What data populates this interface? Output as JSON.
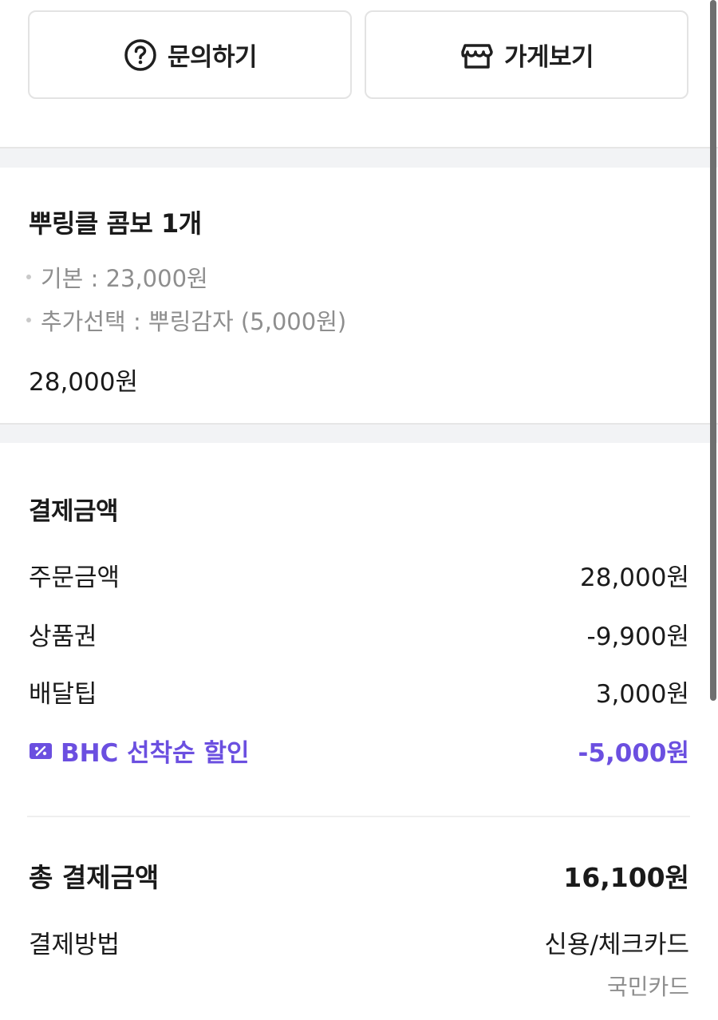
{
  "actions": {
    "inquiry_label": "문의하기",
    "store_label": "가게보기"
  },
  "order": {
    "item_title": "뿌링클 콤보 1개",
    "options": [
      "기본 : 23,000원",
      "추가선택 : 뿌링감자 (5,000원)"
    ],
    "item_price": "28,000원"
  },
  "payment": {
    "heading": "결제금액",
    "rows": [
      {
        "label": "주문금액",
        "value": "28,000원"
      },
      {
        "label": "상품권",
        "value": "-9,900원"
      },
      {
        "label": "배달팁",
        "value": "3,000원"
      }
    ],
    "discount": {
      "label": "BHC 선착순 할인",
      "value": "-5,000원",
      "color": "#6b4fe0"
    },
    "total_label": "총 결제금액",
    "total_value": "16,100원",
    "method_label": "결제방법",
    "method_value": "신용/체크카드",
    "method_card": "국민카드"
  },
  "icons": {
    "inquiry": "question-circle-icon",
    "store": "store-icon",
    "coupon": "coupon-icon"
  }
}
